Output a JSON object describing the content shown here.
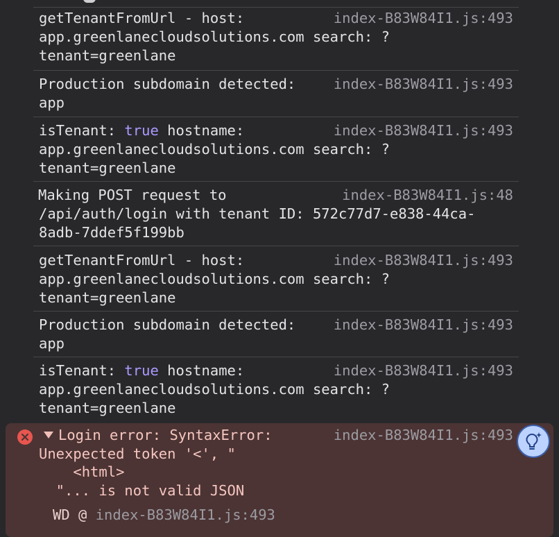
{
  "messages": [
    {
      "lines": [
        "getTenantFromUrl - host:",
        "app.greenlanecloudsolutions.com search: ?",
        "tenant=greenlane"
      ],
      "source": "index-B83W84I1.js:493"
    },
    {
      "lines": [
        "Production subdomain detected:",
        "app"
      ],
      "source": "index-B83W84I1.js:493"
    },
    {
      "lines_rich": {
        "key": "isTenant: ",
        "value": "true",
        "rest": " hostname:"
      },
      "lines": [
        "app.greenlanecloudsolutions.com search: ?",
        "tenant=greenlane"
      ],
      "source": "index-B83W84I1.js:493"
    },
    {
      "lines": [
        "Making POST request to",
        "/api/auth/login with tenant ID: 572c77d7-e838-44ca-",
        "8adb-7ddef5f199bb"
      ],
      "source": "index-B83W84I1.js:48"
    },
    {
      "lines": [
        "getTenantFromUrl - host:",
        "app.greenlanecloudsolutions.com search: ?",
        "tenant=greenlane"
      ],
      "source": "index-B83W84I1.js:493"
    },
    {
      "lines": [
        "Production subdomain detected:",
        "app"
      ],
      "source": "index-B83W84I1.js:493"
    },
    {
      "lines_rich": {
        "key": "isTenant: ",
        "value": "true",
        "rest": " hostname:"
      },
      "lines": [
        "app.greenlanecloudsolutions.com search: ?",
        "tenant=greenlane"
      ],
      "source": "index-B83W84I1.js:493"
    }
  ],
  "error": {
    "lines": [
      "Login error: SyntaxError:",
      "Unexpected token '<', \"",
      "    <html>",
      "  \"... is not valid JSON"
    ],
    "source": "index-B83W84I1.js:493",
    "trace_fn": "WD @ ",
    "trace_link": "index-B83W84I1.js:493",
    "icon": "error-circle-icon"
  },
  "assistant": {
    "icon": "lightbulb-sparkle-icon"
  },
  "colors": {
    "background": "#28282b",
    "keyword": "#a89bff",
    "error_background": "#4c3434",
    "error_text": "#f6c6c0",
    "source_link": "#9c9ca3"
  }
}
